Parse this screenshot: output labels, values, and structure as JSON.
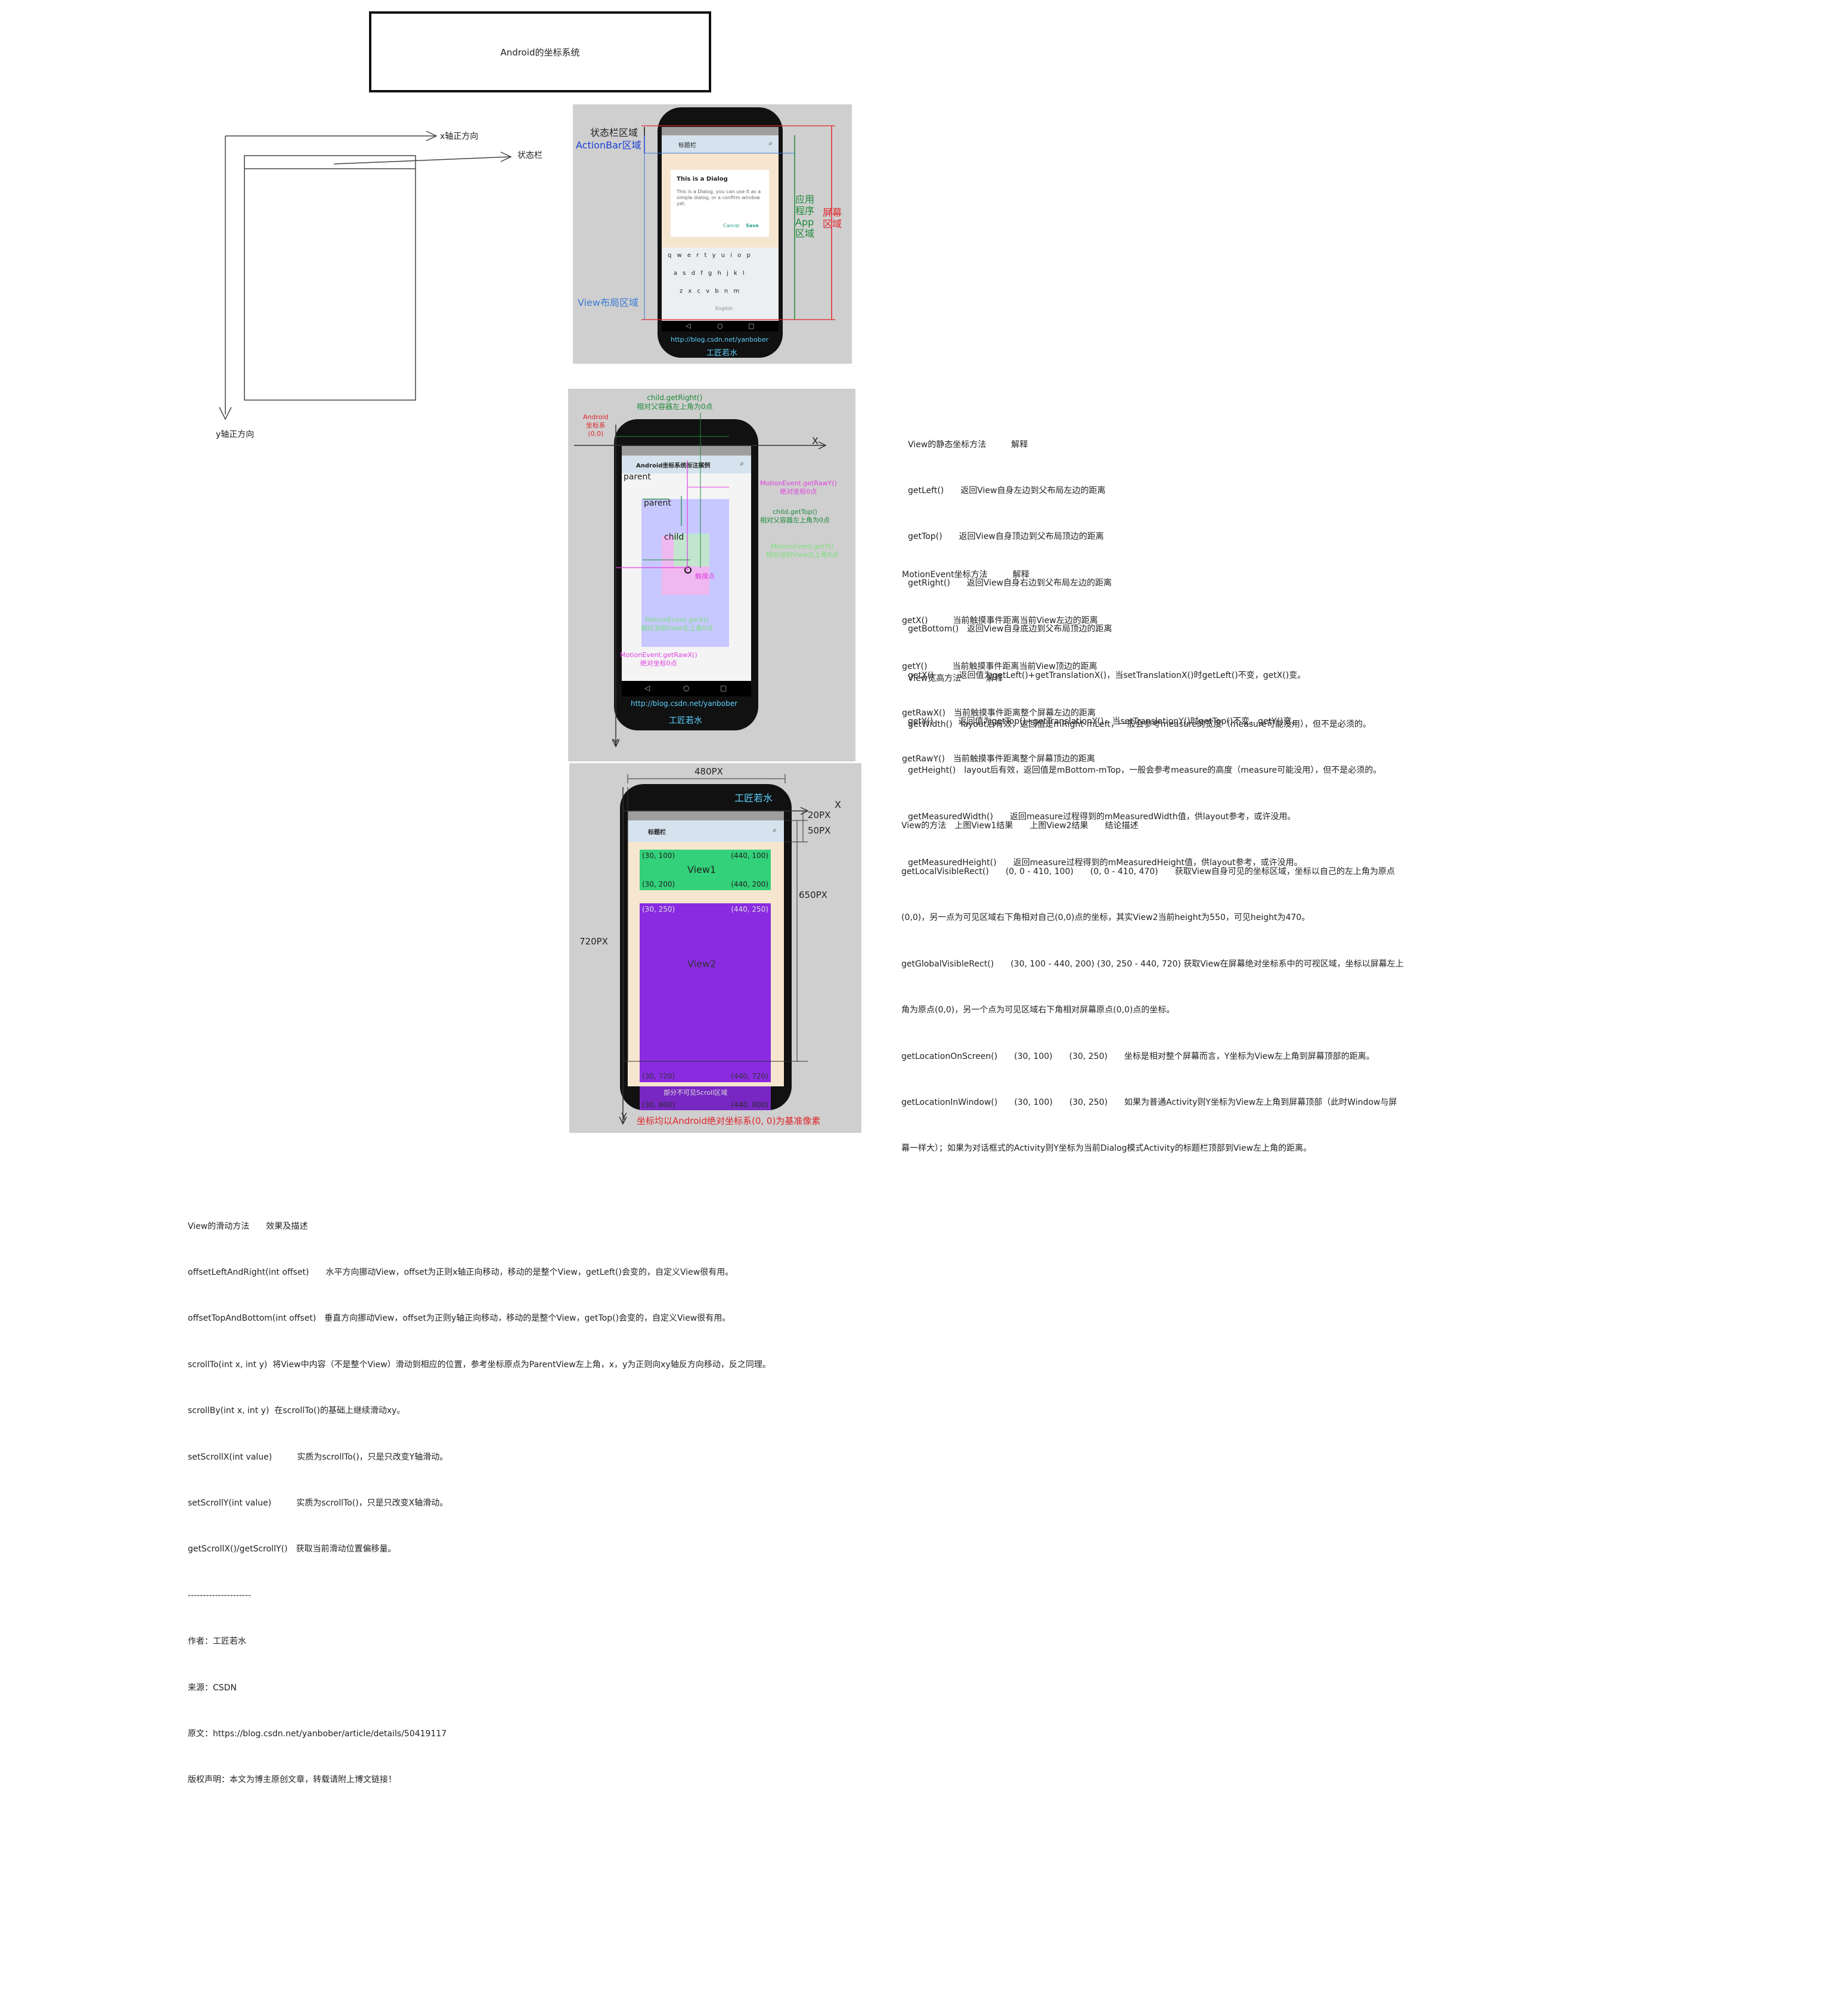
{
  "title_box": "Android的坐标系统",
  "axes_sketch": {
    "x_axis": "x轴正方向",
    "y_axis": "y轴正方向",
    "status_bar": "状态栏"
  },
  "phone1": {
    "status_region": "状态栏区域",
    "actionbar_region": "ActionBar区域",
    "app_region": "应用\n程序\nApp\n区域",
    "screen_region": "屏幕\n区域",
    "view_region": "View布局区域",
    "toolbar_title": "标题栏",
    "dialog_title": "This is a Dialog",
    "dialog_body": "This is a Dialog, you can use it as a simple dialog, or a confirm window yet.",
    "dialog_cancel": "Cancel",
    "dialog_save": "Save",
    "keyboard_rows": [
      "q w e r t y u i o p",
      "a s d f g h j k l",
      "z x c v b n m",
      "English"
    ],
    "url": "http://blog.csdn.net/yanbober",
    "brand": "工匠若水"
  },
  "phone2": {
    "android_origin": "Android\n坐标系\n(0,0)",
    "x": "X",
    "y": "Y",
    "get_right": "child.getRight()\n相对父容器左上角为0点",
    "toolbar_title": "Android坐标系统标注案例",
    "parent_outer": "parent",
    "parent_inner": "parent",
    "child": "child",
    "raw_y": "MotionEvent.getRawY()\n绝对坐标0点",
    "get_top": "child.getTop()\n相对父容器左上角为0点",
    "get_y": "MotionEvent.getY()\n相对当前View左上角0点",
    "touch": "触摸点",
    "get_x": "MotionEvent.getX()\n相对当前View左上角0点",
    "raw_x": "MotionEvent.getRawX()\n绝对坐标0点",
    "url": "http://blog.csdn.net/yanbober",
    "brand": "工匠若水"
  },
  "phone3": {
    "width_480": "480PX",
    "px20": "20PX",
    "px50": "50PX",
    "px650": "650PX",
    "px720": "720PX",
    "x": "X",
    "y": "Y",
    "brand": "工匠若水",
    "toolbar_title": "标题栏",
    "v1_tl": "(30, 100)",
    "v1_tr": "(440, 100)",
    "v1_bl": "(30, 200)",
    "v1_br": "(440, 200)",
    "view1": "View1",
    "v2_tl": "(30, 250)",
    "v2_tr": "(440, 250)",
    "v2_bl": "(30, 720)",
    "v2_br": "(440, 720)",
    "view2": "View2",
    "scroll_region": "部分不可见Scroll区域",
    "v2_bl2": "(30, 800)",
    "v2_br2": "(440, 800)",
    "caption": "坐标均以Android绝对坐标系(0, 0)为基准像素"
  },
  "static_methods": [
    "View的静态坐标方法　　　解释",
    "getLeft()　　返回View自身左边到父布局左边的距离",
    "getTop()　　返回View自身顶边到父布局顶边的距离",
    "getRight()　　返回View自身右边到父布局左边的距离",
    "getBottom()　返回View自身底边到父布局顶边的距离",
    "getX()　　　返回值为getLeft()+getTranslationX()，当setTranslationX()时getLeft()不变，getX()变。",
    "getY()　　　返回值为getTop()+getTranslationY()，当setTranslationY()时getTop()不变，getY()变。"
  ],
  "motion_methods": [
    "MotionEvent坐标方法　　　解释",
    "getX()　　　当前触摸事件距离当前View左边的距离",
    "getY()　　　当前触摸事件距离当前View顶边的距离",
    "getRawX()　当前触摸事件距离整个屏幕左边的距离",
    "getRawY()　当前触摸事件距离整个屏幕顶边的距离"
  ],
  "size_methods": [
    "View宽高方法　　　解释",
    "getWidth()　layout后有效，返回值是mRight-mLeft，一般会参考measure的宽度（measure可能没用），但不是必须的。",
    "getHeight()　layout后有效，返回值是mBottom-mTop，一般会参考measure的高度（measure可能没用），但不是必须的。",
    "getMeasuredWidth()　　返回measure过程得到的mMeasuredWidth值，供layout参考，或许没用。",
    "getMeasuredHeight()　　返回measure过程得到的mMeasuredHeight值，供layout参考，或许没用。"
  ],
  "rect_methods": [
    "View的方法　上图View1结果　　上图View2结果　　结论描述",
    "getLocalVisibleRect()　　(0, 0 - 410, 100)　　(0, 0 - 410, 470)　　获取View自身可见的坐标区域，坐标以自己的左上角为原点",
    "(0,0)，另一点为可见区域右下角相对自己(0,0)点的坐标，其实View2当前height为550，可见height为470。",
    "getGlobalVisibleRect()　　(30, 100 - 440, 200) (30, 250 - 440, 720) 获取View在屏幕绝对坐标系中的可视区域，坐标以屏幕左上",
    "角为原点(0,0)，另一个点为可见区域右下角相对屏幕原点(0,0)点的坐标。",
    "getLocationOnScreen()　　(30, 100)　　(30, 250)　　坐标是相对整个屏幕而言，Y坐标为View左上角到屏幕顶部的距离。",
    "getLocationInWindow()　　(30, 100)　　(30, 250)　　如果为普通Activity则Y坐标为View左上角到屏幕顶部（此时Window与屏",
    "幕一样大）；如果为对话框式的Activity则Y坐标为当前Dialog模式Activity的标题栏顶部到View左上角的距离。"
  ],
  "scroll_methods": [
    "View的滑动方法　　效果及描述",
    "offsetLeftAndRight(int offset)　　水平方向挪动View，offset为正则x轴正向移动，移动的是整个View，getLeft()会变的，自定义View很有用。",
    "offsetTopAndBottom(int offset)　垂直方向挪动View，offset为正则y轴正向移动，移动的是整个View，getTop()会变的，自定义View很有用。",
    "scrollTo(int x, int y)  将View中内容（不是整个View）滑动到相应的位置，参考坐标原点为ParentView左上角，x，y为正则向xy轴反方向移动，反之同理。",
    "scrollBy(int x, int y)  在scrollTo()的基础上继续滑动xy。",
    "setScrollX(int value)　　　实质为scrollTo()，只是只改变Y轴滑动。",
    "setScrollY(int value)　　　实质为scrollTo()，只是只改变X轴滑动。",
    "getScrollX()/getScrollY()　获取当前滑动位置偏移量。",
    "---------------------",
    "作者：工匠若水",
    "来源：CSDN",
    "原文：https://blog.csdn.net/yanbober/article/details/50419117",
    "版权声明：本文为博主原创文章，转载请附上博文链接！"
  ],
  "colors": {
    "panel": "#cfcfcf",
    "phone": "#111111",
    "red": "#e0262b",
    "green": "#1d8a3a",
    "blue": "#3a7bd5",
    "magenta": "#e040e0",
    "view1": "#33d17a",
    "view2": "#8a2be2"
  }
}
